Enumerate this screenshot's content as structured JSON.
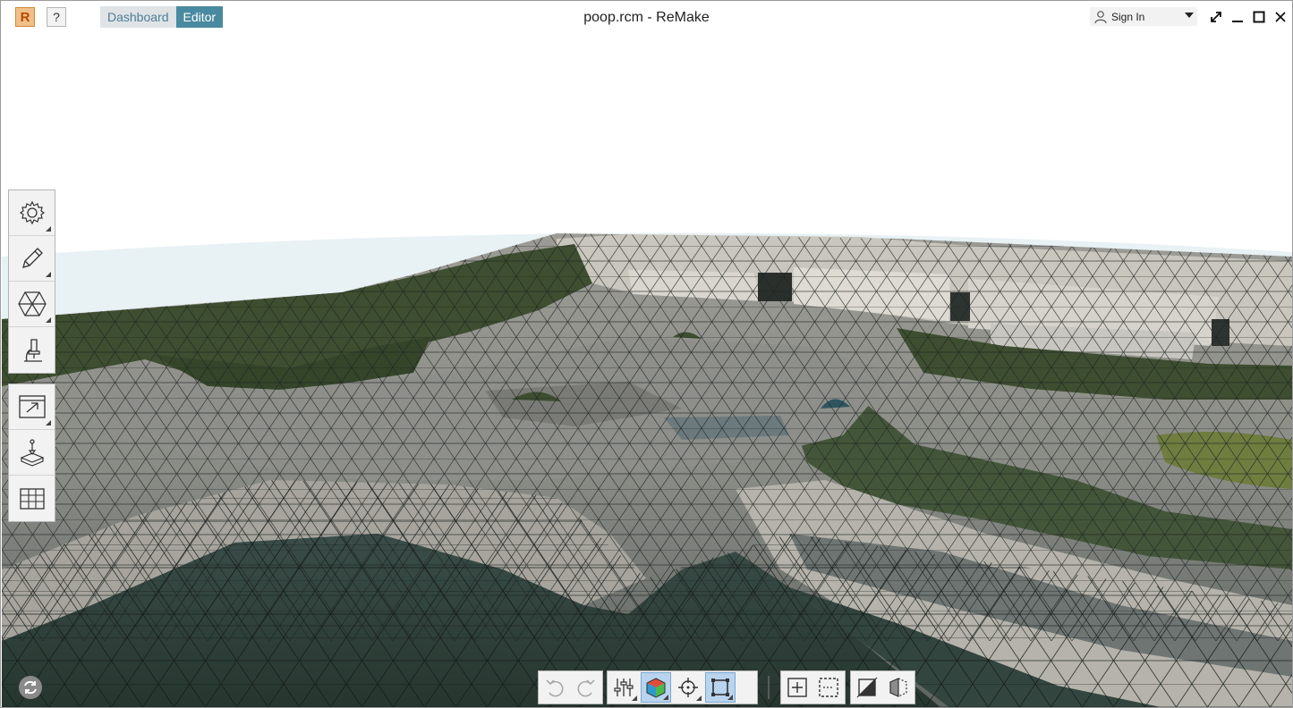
{
  "window": {
    "title": "poop.rcm - ReMake",
    "logo_letter": "R",
    "help_label": "?"
  },
  "tabs": [
    {
      "label": "Dashboard",
      "active": false
    },
    {
      "label": "Editor",
      "active": true
    }
  ],
  "account": {
    "signin_label": "Sign In",
    "icon": "user-icon"
  },
  "window_controls": [
    "fullscreen-icon",
    "minimize-icon",
    "maximize-icon",
    "close-icon"
  ],
  "left_toolbar": {
    "group1": [
      "settings-icon",
      "pencil-icon",
      "mesh-hexagon-icon",
      "microscope-icon"
    ],
    "group2": [
      "export-icon",
      "print-icon",
      "grid-icon"
    ]
  },
  "bottom_toolbar": {
    "group1": [
      "undo-icon",
      "redo-icon"
    ],
    "group2": [
      "sliders-icon",
      "display-mode-cube-icon",
      "pivot-target-icon",
      "fit-view-icon"
    ],
    "group3": [
      "select-add-icon",
      "select-box-icon"
    ],
    "group4": [
      "slice-icon",
      "half-cube-icon"
    ]
  },
  "colors": {
    "accent": "#4a8aa0",
    "tab_inactive_bg": "#dfe3e6",
    "terrain_dark": "#2f4441",
    "terrain_light": "#b8b5ac",
    "vegetation": "#3e4e30",
    "grass_patch": "#6f7d3f",
    "sky_horizon": "#e6f0f3"
  }
}
